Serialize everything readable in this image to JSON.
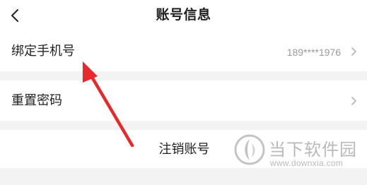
{
  "header": {
    "title": "账号信息",
    "back_icon": "chevron-left-icon"
  },
  "rows": [
    {
      "label": "绑定手机号",
      "value": "189****1976",
      "icon": "chevron-right-icon"
    },
    {
      "label": "重置密码",
      "icon": "chevron-right-icon"
    },
    {
      "label": "注销账号"
    }
  ],
  "annotation": {
    "color": "#e8292b"
  },
  "watermark": {
    "name": "当下软件园",
    "url": "www.downxia.com"
  },
  "colors": {
    "background": "#f3f3f4",
    "card": "#ffffff",
    "text": "#222222",
    "secondary_text": "#9a9a9a",
    "annotation_arrow": "#e8292b"
  }
}
